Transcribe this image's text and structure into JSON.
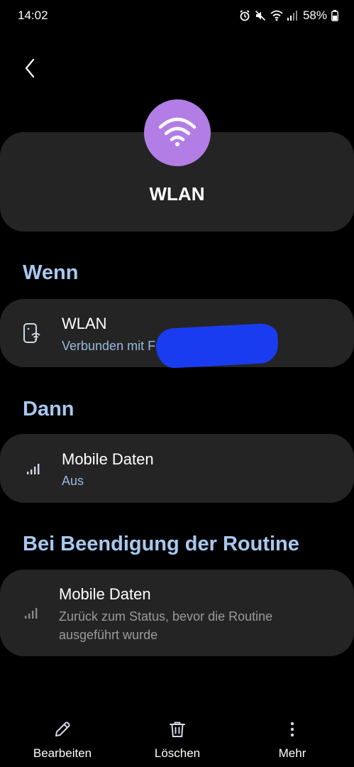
{
  "status_bar": {
    "time": "14:02",
    "battery": "58%",
    "icons": [
      "alarm-icon",
      "mute-icon",
      "wifi-status-icon",
      "signal-icon",
      "battery-icon"
    ]
  },
  "header": {
    "icon": "wifi-icon",
    "icon_color": "#b27ee6",
    "title": "WLAN"
  },
  "sections": {
    "when": {
      "heading": "Wenn",
      "item": {
        "title": "WLAN",
        "subtitle": "Verbunden mit F"
      }
    },
    "then": {
      "heading": "Dann",
      "item": {
        "title": "Mobile Daten",
        "subtitle": "Aus"
      }
    },
    "end": {
      "heading": "Bei Beendigung der Routine",
      "item": {
        "title": "Mobile Daten",
        "subtitle_line1": "Zurück zum Status, bevor die Routine",
        "subtitle_line2": "ausgeführt wurde"
      }
    }
  },
  "bottom_nav": {
    "edit": "Bearbeiten",
    "delete": "Löschen",
    "more": "Mehr"
  },
  "colors": {
    "accent": "#a8c8f0",
    "card_bg": "#242424",
    "redaction": "#1a3cf0"
  }
}
